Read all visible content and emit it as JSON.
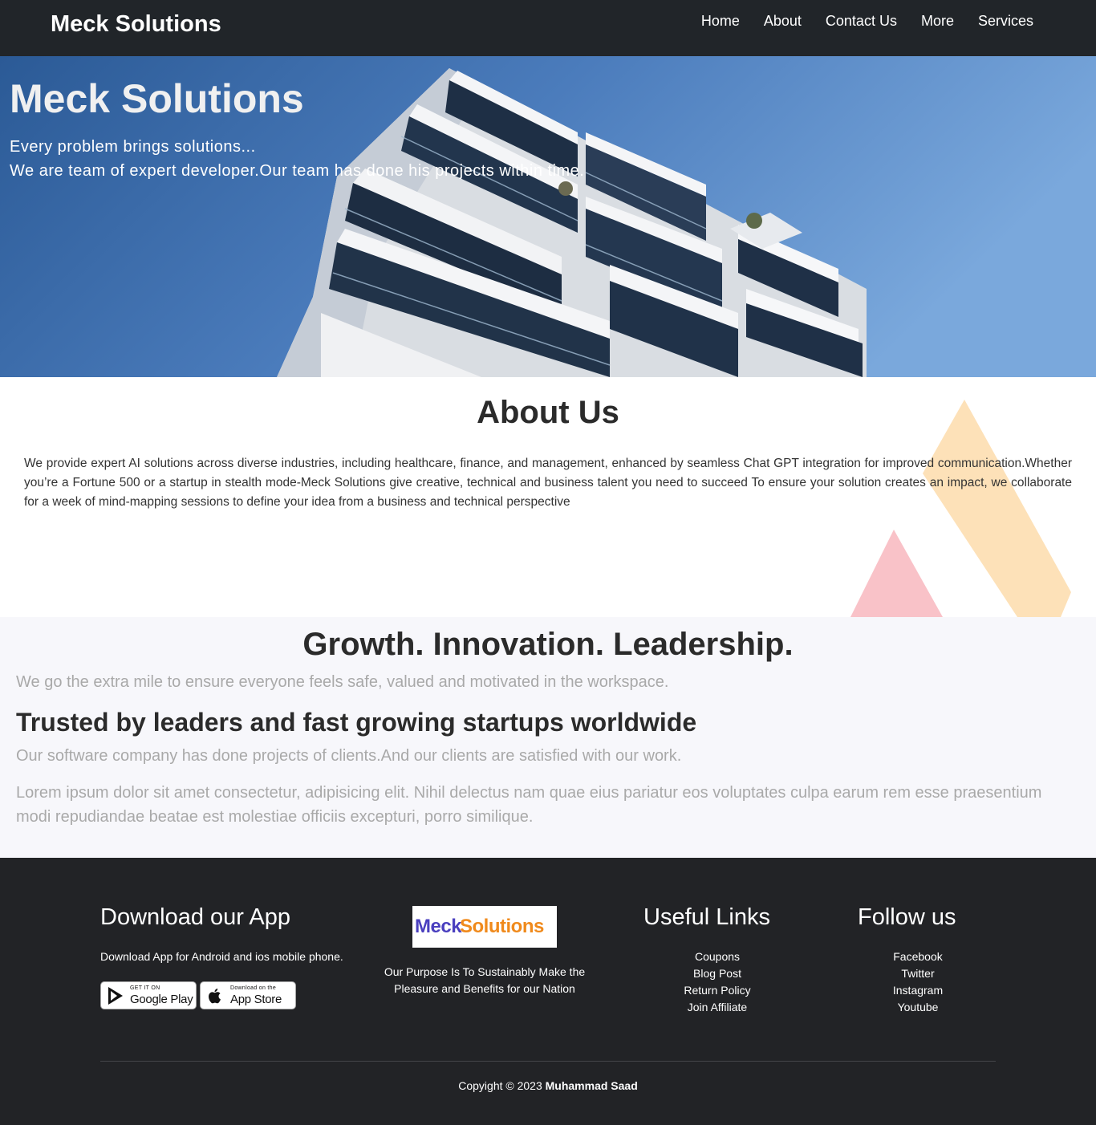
{
  "navbar": {
    "brand": "Meck Solutions",
    "links": [
      "Home",
      "About",
      "Contact Us",
      "More",
      "Services"
    ]
  },
  "hero": {
    "title": "Meck Solutions",
    "line1": "Every problem brings solutions...",
    "line2": "We are team of expert developer.Our team has done his projects within time."
  },
  "about": {
    "title": "About Us",
    "text": "We provide expert AI solutions across diverse industries, including healthcare, finance, and management, enhanced by seamless Chat GPT integration for improved communication.Whether you’re a Fortune 500 or a startup in stealth mode-Meck Solutions give creative, technical and business talent you need to succeed To ensure your solution creates an impact, we collaborate for a week of mind-mapping sessions to define your idea from a business and technical perspective"
  },
  "growth": {
    "title": "Growth. Innovation. Leadership.",
    "subtitle": "We go the extra mile to ensure everyone feels safe, valued and motivated in the workspace.",
    "trusted": "Trusted by leaders and fast growing startups worldwide",
    "clients": "Our software company has done projects of clients.And our clients are satisfied with our work.",
    "lorem": "Lorem ipsum dolor sit amet consectetur, adipisicing elit. Nihil delectus nam quae eius pariatur eos voluptates culpa earum rem esse praesentium modi repudiandae beatae est molestiae officiis excepturi, porro similique."
  },
  "footer": {
    "download_heading": "Download our App",
    "download_text": "Download App for Android and ios mobile phone.",
    "google_play": {
      "small": "GET IT ON",
      "big": "Google Play"
    },
    "app_store": {
      "small": "Download on the",
      "big": "App Store"
    },
    "logo": {
      "part1": "Meck",
      "part2": "Solutions",
      "color1": "#4a3fbf",
      "color2": "#f08a1c"
    },
    "purpose": "Our Purpose Is To Sustainably Make the Pleasure and Benefits for our Nation",
    "useful_heading": "Useful Links",
    "useful_links": [
      "Coupons",
      "Blog Post",
      "Return Policy",
      "Join Affiliate"
    ],
    "follow_heading": "Follow us",
    "follow_links": [
      "Facebook",
      "Twitter",
      "Instagram",
      "Youtube"
    ],
    "copyright_prefix": "Copyight © 2023",
    "copyright_author": "Muhammad Saad"
  },
  "colors": {
    "navbar_bg": "#212529",
    "footer_bg": "#222326",
    "growth_bg": "#f7f7fb",
    "muted_text": "#a9a9a9",
    "deco_pink": "#f9c2c8",
    "deco_orange": "#fde1b8"
  }
}
